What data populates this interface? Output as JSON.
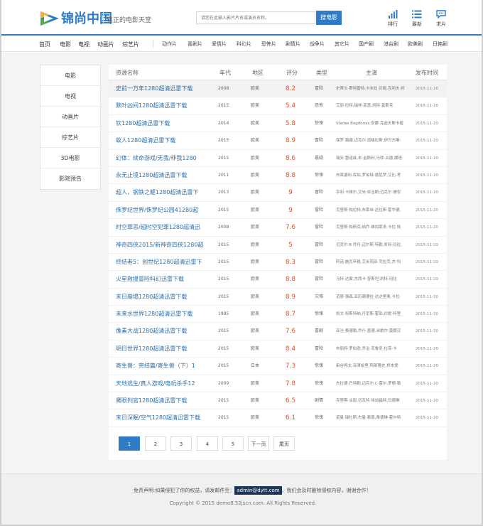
{
  "header": {
    "brand": "锦尚中国",
    "slogan": "真正的电影天堂",
    "search_placeholder": "请您在此输入影片片名或演员名称。",
    "search_button": "搜电影",
    "icons": [
      {
        "label": "排行",
        "icon": "bar-chart-icon"
      },
      {
        "label": "最新",
        "icon": "list-icon"
      },
      {
        "label": "求片",
        "icon": "chat-icon"
      }
    ],
    "accent_color": "#2f7bc6"
  },
  "nav": {
    "main": [
      "首页",
      "电影",
      "电视",
      "动画片",
      "综艺片"
    ],
    "sub": [
      "动作片",
      "喜剧片",
      "爱情片",
      "科幻片",
      "恐怖片",
      "剧情片",
      "战争片",
      "其它片",
      "国产剧",
      "港台剧",
      "欧美剧",
      "日韩剧"
    ]
  },
  "sidebar": {
    "items": [
      "电影",
      "电视",
      "动画片",
      "综艺片",
      "3D电影",
      "影院预告"
    ]
  },
  "table": {
    "headers": [
      "资源名称",
      "年代",
      "地区",
      "评分",
      "类型",
      "主演",
      "发布时间"
    ],
    "rows": [
      {
        "title": "史前一万年1280超清迅雷下载",
        "year": "2008",
        "region": "欧美",
        "score": "8.2",
        "genre": "冒险",
        "stars": "史蒂文·斯特雷特,卡米拉·贝勒,克利夫·柯",
        "date": "2015-11-20"
      },
      {
        "title": "默叶凶间1280超清迅雷下载",
        "year": "2015",
        "region": "欧美",
        "score": "5.4",
        "genre": "恐怖",
        "stars": "艾丽·拉特,瑞林·菲盖,凯特·莫斯克",
        "date": "2015-11-20"
      },
      {
        "title": "钦1280超清迅雷下载",
        "year": "2014",
        "region": "欧美",
        "score": "5.8",
        "genre": "惊悚",
        "stars": "Vladas Bagdonas,安娜·克迪夫斯卡娅",
        "date": "2015-11-20"
      },
      {
        "title": "蚁人1280超清迅雷下载",
        "year": "2015",
        "region": "欧美",
        "score": "8.9",
        "genre": "冒险",
        "stars": "保罗·路德,迈克尔·道格拉斯,伊万杰琳·",
        "date": "2015-11-20"
      },
      {
        "title": "幻体：续命游戏/无我/非我1280",
        "year": "2015",
        "region": "欧美",
        "score": "8.6",
        "genre": "悬疑",
        "stars": "瑞安·雷诺兹,本·金斯利,马修·古德,娜塔",
        "date": "2015-11-20"
      },
      {
        "title": "永无止境1280超清迅雷下载",
        "year": "2011",
        "region": "欧美",
        "score": "8.8",
        "genre": "惊悚",
        "stars": "布莱德利·库珀,罗伯特·德尼罗,艾比·考",
        "date": "2015-11-20"
      },
      {
        "title": "超人，钢铁之躯1280超清迅雷下",
        "year": "2013",
        "region": "欧美",
        "score": "9",
        "genre": "冒险",
        "stars": "亨利·卡维尔,艾米·亚当斯,迈克尔·珊农",
        "date": "2015-11-20"
      },
      {
        "title": "侏罗纪世界/侏罗纪公园41280超",
        "year": "2015",
        "region": "欧美",
        "score": "9",
        "genre": "冒险",
        "stars": "克里斯·帕拉特,布莱丝·达拉斯·霍华德,",
        "date": "2015-11-20"
      },
      {
        "title": "时空罪恶/超时空犯罪1280超清迅",
        "year": "2008",
        "region": "欧美",
        "score": "7.6",
        "genre": "冒险",
        "stars": "克里斯·帕斯克,纳乔·维加莱多,卡拉·埃",
        "date": "2015-11-20"
      },
      {
        "title": "神奇四侠2015/新神奇四侠1280超",
        "year": "2015",
        "region": "欧美",
        "score": "5",
        "genre": "冒险",
        "stars": "迈克尔·B·乔丹,迈尔斯·特勒,凯特·玛拉,",
        "date": "2015-11-20"
      },
      {
        "title": "终结者5：创世纪1280超清迅雷下",
        "year": "2015",
        "region": "欧美",
        "score": "8.3",
        "genre": "冒险",
        "stars": "阿诺·施瓦辛格,艾米莉亚·克拉克,杰·科",
        "date": "2015-11-20"
      },
      {
        "title": "火星救援冒险科幻迅雷下载",
        "year": "2015",
        "region": "欧美",
        "score": "8.8",
        "genre": "冒险",
        "stars": "马特·达蒙,杰西卡·查斯坦,凯特·玛拉",
        "date": "2015-11-20"
      },
      {
        "title": "末日崩塌1280超清迅雷下载",
        "year": "2015",
        "region": "欧美",
        "score": "8.9",
        "genre": "灾难",
        "stars": "道恩·强森,亚历珊德拉·达达里奥,卡拉·",
        "date": "2015-11-20"
      },
      {
        "title": "未来水世界1280超清迅雷下载",
        "year": "1995",
        "region": "欧美",
        "score": "8.7",
        "genre": "惊悚",
        "stars": "凯文·科斯特纳,丹尼斯·霍珀,珍妮·特里",
        "date": "2015-11-20"
      },
      {
        "title": "像素大战1280超清迅雷下载",
        "year": "2015",
        "region": "欧美",
        "score": "7.6",
        "genre": "喜剧",
        "stars": "亚当·桑德勒,乔什·盖德,米歇尔·莫娜汉",
        "date": "2015-11-20"
      },
      {
        "title": "明日世界1280超清迅雷下载",
        "year": "2015",
        "region": "欧美",
        "score": "8.4",
        "genre": "冒险",
        "stars": "布丽特·罗伯逊,乔治·克鲁尼,拉菲·卡",
        "date": "2015-11-20"
      },
      {
        "title": "寄生兽：完结篇/寄生兽（下）1",
        "year": "2015",
        "region": "日本",
        "score": "7.3",
        "genre": "惊悚",
        "stars": "染谷将太,深津绘里,阿部隆史,桥本爱",
        "date": "2015-11-20"
      },
      {
        "title": "天地逃生/真人游戏/电玩杀手12",
        "year": "2009",
        "region": "欧美",
        "score": "7.8",
        "genre": "惊悚",
        "stars": "杰拉德·巴特勒,迈克尔·C·霍尔,罗根·勒",
        "date": "2015-11-20"
      },
      {
        "title": "鹰眼判官1280超清迅雷下载",
        "year": "2015",
        "region": "欧美",
        "score": "6.5",
        "genre": "剧情",
        "stars": "克里斯·派恩,切瓦特·埃加福特,玛德琳",
        "date": "2015-11-20"
      },
      {
        "title": "末日深眠/空气1280超清迅雷下载",
        "year": "2015",
        "region": "欧美",
        "score": "6.1",
        "genre": "惊悚",
        "stars": "诺曼·瑞杜斯,杰曼·赖恩,桑德琳·霍尔特",
        "date": "2015-11-20"
      }
    ]
  },
  "pager": {
    "buttons": [
      "1",
      "2",
      "3",
      "4",
      "5",
      "下一页",
      "尾页"
    ],
    "active": "1"
  },
  "footer": {
    "disclaimer_before": "免责声明:如果侵犯了你的权益，请发邮件至：",
    "email": "admin@dytt.com",
    "disclaimer_after": "，我们会及时删除侵权内容，谢谢合作！",
    "copyright": "Copyright © 2015 demo8.52jscn.com. All Rights Reserved."
  }
}
